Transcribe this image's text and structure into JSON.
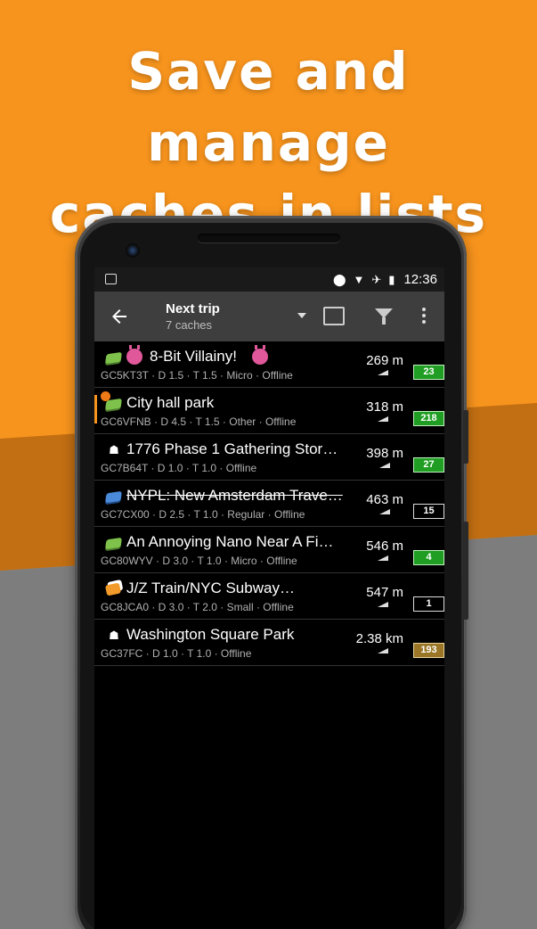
{
  "headline": {
    "line1": "Save and manage",
    "line2": "caches in lists"
  },
  "status_bar": {
    "time": "12:36",
    "icons": [
      "image-icon",
      "location-icon",
      "wifi-icon",
      "airplane-icon",
      "battery-icon"
    ]
  },
  "toolbar": {
    "title": "Next trip",
    "subtitle": "7 caches"
  },
  "caches": [
    {
      "name": "8-Bit Villainy!",
      "info": "GC5KT3T · D 1.5 · T 1.5 · Micro · Offline",
      "distance": "269 m",
      "badge": "23",
      "badge_style": "green",
      "icon": "traditional-cache-icon",
      "strike": false
    },
    {
      "name": "City hall park",
      "info": "GC6VFNB · D 4.5 · T 1.5 · Other · Offline",
      "distance": "318 m",
      "badge": "218",
      "badge_style": "green",
      "icon": "traditional-cache-icon",
      "strike": false
    },
    {
      "name": "1776 Phase 1 Gathering Stor…",
      "info": "GC7B64T · D 1.0 · T 1.0 · Offline",
      "distance": "398 m",
      "badge": "27",
      "badge_style": "green",
      "icon": "event-cache-icon",
      "strike": false
    },
    {
      "name": "NYPL: New Amsterdam Trave…",
      "info": "GC7CX00 · D 2.5 · T 1.0 · Regular · Offline",
      "distance": "463 m",
      "badge": "15",
      "badge_style": "black",
      "icon": "virtual-cache-icon",
      "strike": true
    },
    {
      "name": "An Annoying Nano Near A FiD…",
      "info": "GC80WYV · D 3.0 · T 1.0 · Micro · Offline",
      "distance": "546 m",
      "badge": "4",
      "badge_style": "green",
      "icon": "traditional-cache-icon",
      "strike": false
    },
    {
      "name": "J/Z Train/NYC Subway…",
      "info": "GC8JCA0 · D 3.0 · T 2.0 · Small · Offline",
      "distance": "547 m",
      "badge": "1",
      "badge_style": "black",
      "icon": "multi-cache-icon",
      "strike": false
    },
    {
      "name": "Washington Square Park",
      "info": "GC37FC · D 1.0 · T 1.0 · Offline",
      "distance": "2.38 km",
      "badge": "193",
      "badge_style": "gold",
      "icon": "event-cache-icon",
      "strike": false
    }
  ]
}
